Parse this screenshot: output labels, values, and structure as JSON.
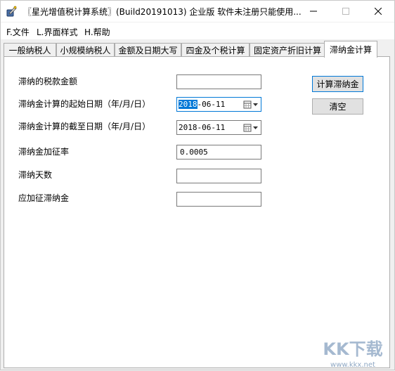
{
  "window": {
    "title": "〖星光增值税计算系统〗(Build20191013) 企业版 软件未注册只能使用..."
  },
  "menu": {
    "items": [
      "F.文件",
      "L.界面样式",
      "H.帮助"
    ]
  },
  "tabs": {
    "items": [
      "一般纳税人",
      "小规模纳税人",
      "金额及日期大写",
      "四金及个税计算",
      "固定资产折旧计算",
      "滞纳金计算"
    ],
    "active_index": 5
  },
  "form": {
    "tax_amount_label": "滞纳的税款金额",
    "tax_amount_value": "",
    "start_date_label": "滞纳金计算的起始日期（年/月/日）",
    "start_date_year": "2018",
    "start_date_rest": "-06-11",
    "end_date_label": "滞纳金计算的截至日期（年/月/日）",
    "end_date_value": "2018-06-11",
    "rate_label": "滞纳金加征率",
    "rate_value": "0.0005",
    "days_label": "滞纳天数",
    "days_value": "",
    "late_fee_label": "应加征滞纳金",
    "late_fee_value": ""
  },
  "buttons": {
    "calculate_label": "计算滞纳金",
    "clear_label": "清空"
  },
  "watermark": {
    "logo_text": "KK下载",
    "url": "www.kkx.net"
  },
  "colors": {
    "accent": "#0078d7",
    "watermark": "#8fa8c4"
  }
}
